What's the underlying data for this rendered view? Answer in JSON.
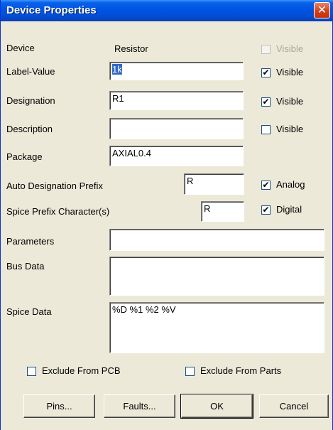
{
  "window": {
    "title": "Device Properties",
    "close_glyph": "✕"
  },
  "fields": {
    "device_label": "Device",
    "device_value": "Resistor",
    "label_value_label": "Label-Value",
    "label_value": "1k",
    "designation_label": "Designation",
    "designation_value": "R1",
    "description_label": "Description",
    "description_value": "",
    "package_label": "Package",
    "package_value": "AXIAL0.4",
    "auto_designation_prefix_label": "Auto Designation Prefix",
    "auto_designation_prefix_value": "R",
    "spice_prefix_label": "Spice Prefix Character(s)",
    "spice_prefix_value": "R",
    "parameters_label": "Parameters",
    "parameters_value": "",
    "bus_data_label": "Bus Data",
    "bus_data_value": "",
    "spice_data_label": "Spice Data",
    "spice_data_value": "%D %1 %2 %V"
  },
  "checkboxes": {
    "device_visible": {
      "label": "Visible",
      "checked": false,
      "enabled": false
    },
    "label_value_visible": {
      "label": "Visible",
      "checked": true,
      "enabled": true
    },
    "designation_visible": {
      "label": "Visible",
      "checked": true,
      "enabled": true
    },
    "description_visible": {
      "label": "Visible",
      "checked": false,
      "enabled": true
    },
    "analog": {
      "label": "Analog",
      "checked": true,
      "enabled": true
    },
    "digital": {
      "label": "Digital",
      "checked": true,
      "enabled": true
    },
    "exclude_pcb": {
      "label": "Exclude From PCB",
      "checked": false,
      "enabled": true
    },
    "exclude_parts": {
      "label": "Exclude From Parts",
      "checked": false,
      "enabled": true
    }
  },
  "buttons": {
    "pins": "Pins...",
    "faults": "Faults...",
    "ok": "OK",
    "cancel": "Cancel"
  },
  "colors": {
    "title_bar": "#0055e5",
    "dialog_background": "#ece9d8",
    "selection": "#316ac5"
  }
}
